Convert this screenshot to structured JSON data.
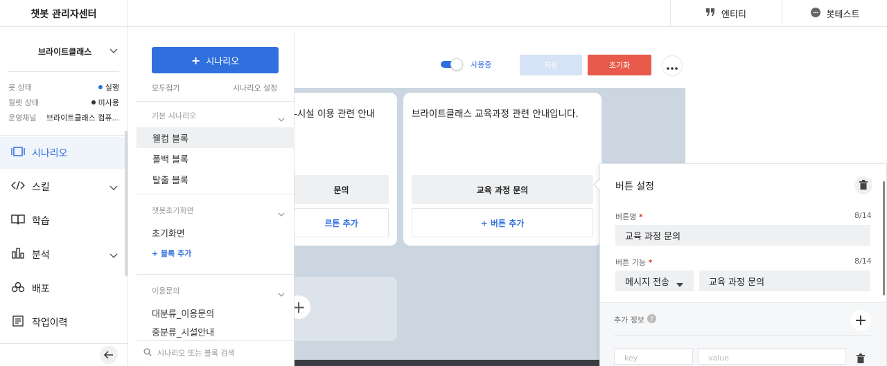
{
  "app": {
    "title": "챗봇 관리자센터"
  },
  "topbar": {
    "entity_label": "엔티티",
    "bottest_label": "봇테스트"
  },
  "sidebar": {
    "org_name": "브라이트클래스",
    "status": [
      {
        "label": "봇 상태",
        "value": "실행",
        "dot_color": "#2f6fde"
      },
      {
        "label": "월렛 상태",
        "value": "미사용",
        "dot_color": "#333333"
      },
      {
        "label": "운영채널",
        "value": "브라이트클래스 컴퓨..."
      }
    ],
    "nav": [
      {
        "label": "시나리오",
        "icon": "scenario-icon",
        "active": true
      },
      {
        "label": "스킬",
        "icon": "code-icon",
        "expandable": true
      },
      {
        "label": "학습",
        "icon": "book-icon"
      },
      {
        "label": "분석",
        "icon": "bar-chart-icon",
        "expandable": true
      },
      {
        "label": "배포",
        "icon": "deploy-icon"
      },
      {
        "label": "작업이력",
        "icon": "history-icon"
      }
    ]
  },
  "scenario_panel": {
    "add_button": "시나리오",
    "collapse_all": "모두접기",
    "settings": "시나리오 설정",
    "groups": [
      {
        "title": "기본 시나리오",
        "items": [
          "웰컴 블록",
          "폴백 블록",
          "탈출 블록"
        ],
        "selected": 0
      },
      {
        "title": "챗봇초기화면",
        "items": [
          "초기화면"
        ],
        "add_block": "+ 블록 추가"
      },
      {
        "title": "이용문의",
        "items": [
          "대분류_이용문의",
          "중분류_시설안내"
        ]
      }
    ],
    "search_placeholder": "시나리오 또는 블록 검색"
  },
  "toolbar": {
    "use_label": "사용중",
    "save_label": "저장",
    "reset_label": "초기화",
    "accent": "#2f6fde",
    "danger": "#e85a4b"
  },
  "cards": [
    {
      "text": "-시설 이용 관련 안내",
      "button": "문의",
      "add": "르튼 추가"
    },
    {
      "text": "브라이트클래스 교육과정 관련 안내입니다.",
      "button": "교육 과정 문의",
      "add": "+ 버튼 추가"
    }
  ],
  "button_settings": {
    "title": "버튼 설정",
    "name_label": "버튼명",
    "name_count": "8/14",
    "name_value": "교육 과정 문의",
    "func_label": "버튼 기능",
    "func_count": "8/14",
    "func_type": "메시지 전송",
    "func_value": "교육 과정 문의",
    "extra_label": "추가 정보",
    "key_placeholder": "key",
    "value_placeholder": "value"
  }
}
